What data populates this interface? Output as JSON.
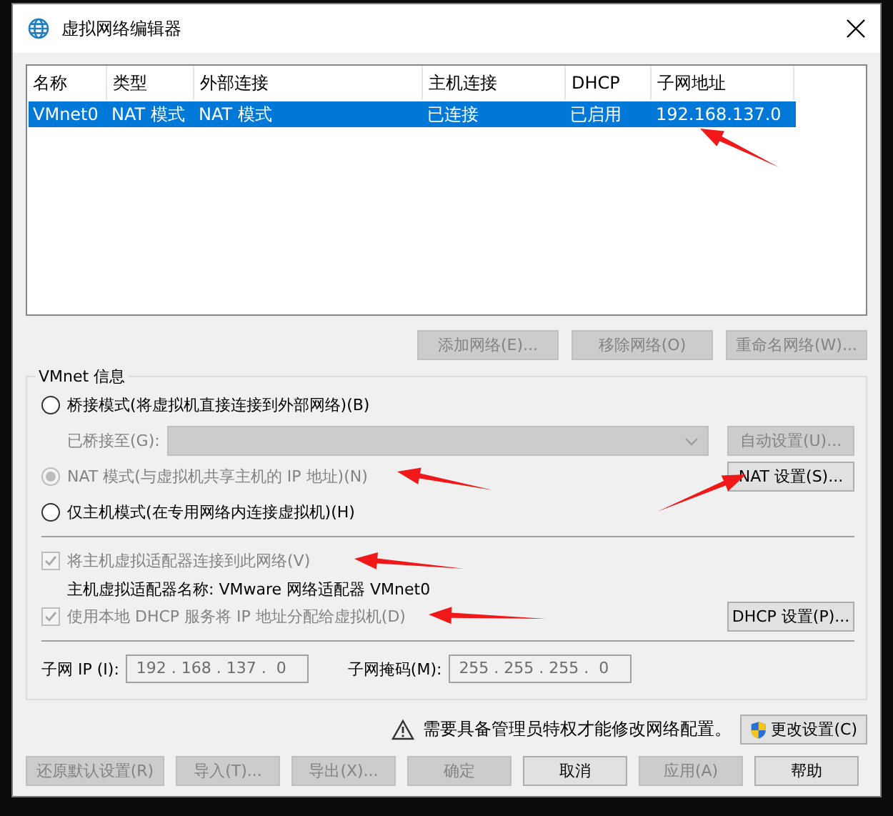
{
  "window": {
    "title": "虚拟网络编辑器"
  },
  "table": {
    "columns": [
      "名称",
      "类型",
      "外部连接",
      "主机连接",
      "DHCP",
      "子网地址"
    ],
    "rows": [
      {
        "cells": [
          "VMnet0",
          "NAT 模式",
          "NAT 模式",
          "已连接",
          "已启用",
          "192.168.137.0"
        ],
        "selected": true
      }
    ]
  },
  "table_buttons": [
    {
      "label": "添加网络(E)...",
      "disabled": true
    },
    {
      "label": "移除网络(O)",
      "disabled": true
    },
    {
      "label": "重命名网络(W)...",
      "disabled": true
    }
  ],
  "vmnet_info": {
    "title": "VMnet 信息",
    "modes": [
      {
        "kind": "radio",
        "label": "桥接模式(将虚拟机直接连接到外部网络)(B)",
        "selected": false,
        "disabled": false
      },
      {
        "kind": "bridge",
        "label": "已桥接至(G):",
        "disabled": true,
        "button": {
          "label": "自动设置(U)...",
          "disabled": true
        }
      },
      {
        "kind": "radio",
        "label": "NAT 模式(与虚拟机共享主机的 IP 地址)(N)",
        "selected": true,
        "disabled": true,
        "button": {
          "label": "NAT 设置(S)...",
          "disabled": false
        }
      },
      {
        "kind": "radio",
        "label": "仅主机模式(在专用网络内连接虚拟机)(H)",
        "selected": false,
        "disabled": false
      }
    ],
    "options": [
      {
        "kind": "checkbox",
        "label": "将主机虚拟适配器连接到此网络(V)",
        "checked": true,
        "disabled": true
      },
      {
        "kind": "note",
        "label": "主机虚拟适配器名称: VMware 网络适配器 VMnet0"
      },
      {
        "kind": "checkbox",
        "label": "使用本地 DHCP 服务将 IP 地址分配给虚拟机(D)",
        "checked": true,
        "disabled": true,
        "button": {
          "label": "DHCP 设置(P)...",
          "disabled": false
        }
      }
    ],
    "subnet_ip": {
      "label": "子网 IP (I):",
      "value": "192 . 168 . 137 .  0"
    },
    "subnet_mask": {
      "label": "子网掩码(M):",
      "value": "255 . 255 . 255 .  0"
    }
  },
  "admin_notice": {
    "text": "需要具备管理员特权才能修改网络配置。",
    "button": {
      "label": "更改设置(C)",
      "disabled": false
    }
  },
  "footer_buttons": [
    {
      "label": "还原默认设置(R)",
      "disabled": true
    },
    {
      "label": "导入(T)...",
      "disabled": true
    },
    {
      "label": "导出(X)...",
      "disabled": true
    },
    {
      "label": "确定",
      "disabled": true
    },
    {
      "label": "取消",
      "disabled": false
    },
    {
      "label": "应用(A)",
      "disabled": true
    },
    {
      "label": "帮助",
      "disabled": false
    }
  ],
  "annotations": [
    {
      "kind": "arrow"
    },
    {
      "kind": "arrow"
    },
    {
      "kind": "arrow"
    },
    {
      "kind": "arrow"
    },
    {
      "kind": "arrow"
    }
  ]
}
